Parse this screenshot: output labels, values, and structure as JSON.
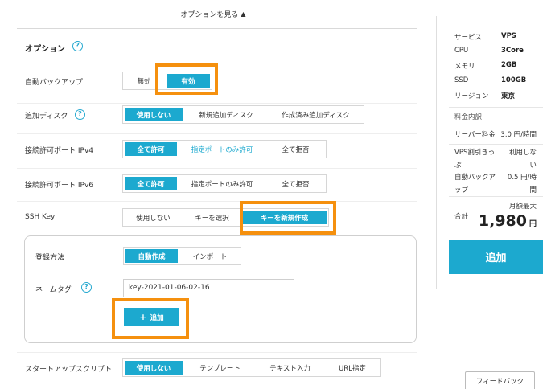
{
  "options_toggle": {
    "label": "オプションを見る",
    "chevron_icon": "chevron-up-icon"
  },
  "section_title": "オプション",
  "help_glyph": "?",
  "auto_backup": {
    "label": "自動バックアップ",
    "options": [
      "無効",
      "有効"
    ],
    "selected": "有効"
  },
  "additional_disk": {
    "label": "追加ディスク",
    "options": [
      "使用しない",
      "新規追加ディスク",
      "作成済み追加ディスク"
    ],
    "selected": "使用しない"
  },
  "port_ipv4": {
    "label": "接続許可ポート IPv4",
    "options": [
      "全て許可",
      "指定ポートのみ許可",
      "全て拒否"
    ],
    "selected": "全て許可"
  },
  "port_ipv6": {
    "label": "接続許可ポート IPv6",
    "options": [
      "全て許可",
      "指定ポートのみ許可",
      "全て拒否"
    ],
    "selected": "全て許可"
  },
  "ssh_key": {
    "label": "SSH Key",
    "options": [
      "使用しない",
      "キーを選択",
      "キーを新規作成"
    ],
    "selected": "キーを新規作成"
  },
  "registration": {
    "method_label": "登録方法",
    "method_options": [
      "自動作成",
      "インポート"
    ],
    "method_selected": "自動作成",
    "name_tag_label": "ネームタグ",
    "name_tag_value": "key-2021-01-06-02-16",
    "add_button": "追加",
    "plus_glyph": "+"
  },
  "startup_script": {
    "label": "スタートアップスクリプト",
    "options": [
      "使用しない",
      "テンプレート",
      "テキスト入力",
      "URL指定"
    ],
    "selected": "使用しない"
  },
  "summary": {
    "specs": [
      {
        "label": "サービス",
        "value": "VPS"
      },
      {
        "label": "CPU",
        "value": "3Core"
      },
      {
        "label": "メモリ",
        "value": "2GB"
      },
      {
        "label": "SSD",
        "value": "100GB"
      },
      {
        "label": "リージョン",
        "value": "東京"
      }
    ],
    "breakdown_title": "料金内訳",
    "breakdown": [
      {
        "label_lines": [
          "サーバー料金"
        ],
        "value_lines": [
          "3.0 円/時間"
        ]
      },
      {
        "label_lines": [
          "VPS割引きっ",
          "ぷ"
        ],
        "value_lines": [
          "利用しな",
          "い"
        ]
      },
      {
        "label_lines": [
          "自動バックア",
          "ップ"
        ],
        "value_lines": [
          "0.5 円/時",
          "間"
        ]
      }
    ],
    "total_label": "合計",
    "monthly_max": "月額最大",
    "total_amount": "1,980",
    "currency": "円",
    "add_button": "追加"
  },
  "feedback_button": "フィードバック",
  "colors": {
    "accent": "#1ca9cf",
    "highlight": "#f5900e"
  }
}
